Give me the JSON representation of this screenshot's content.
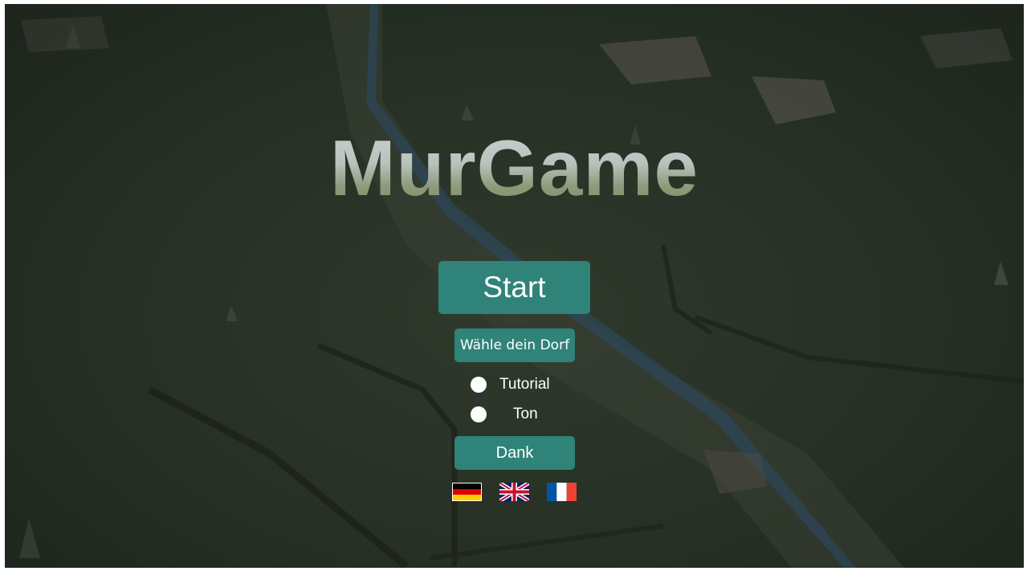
{
  "title": "MurGame",
  "menu": {
    "start_label": "Start",
    "village_label": "Wähle dein Dorf",
    "tutorial_label": "Tutorial",
    "sound_label": "Ton",
    "credits_label": "Dank"
  },
  "toggles": {
    "tutorial_checked": false,
    "sound_checked": false
  },
  "languages": [
    "german-flag-icon",
    "uk-flag-icon",
    "french-flag-icon"
  ],
  "colors": {
    "button": "#2f8378",
    "button_text": "#ffffff",
    "background": "#263024"
  }
}
